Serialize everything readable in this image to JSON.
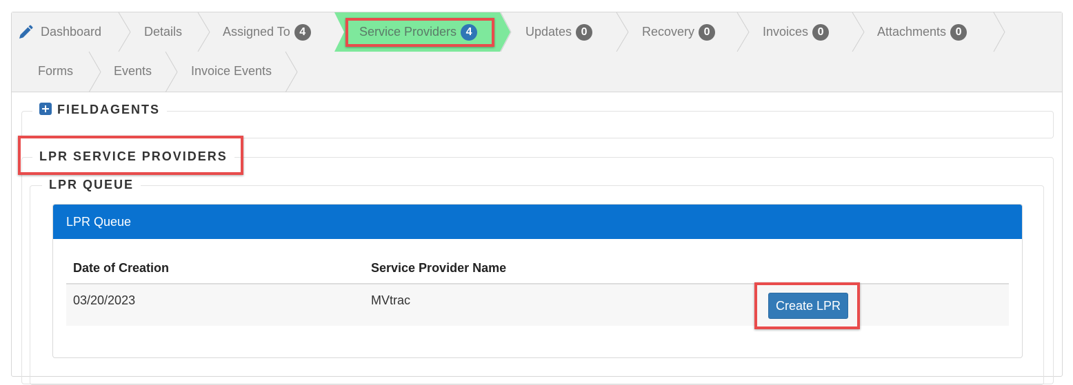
{
  "tabs": [
    {
      "label": "Dashboard",
      "icon": "pencil-icon"
    },
    {
      "label": "Details"
    },
    {
      "label": "Assigned To",
      "badge": "4"
    },
    {
      "label": "Service Providers",
      "badge": "4",
      "active": true
    },
    {
      "label": "Updates",
      "badge": "0"
    },
    {
      "label": "Recovery",
      "badge": "0"
    },
    {
      "label": "Invoices",
      "badge": "0"
    },
    {
      "label": "Attachments",
      "badge": "0"
    },
    {
      "label": "Forms"
    },
    {
      "label": "Events"
    },
    {
      "label": "Invoice Events"
    }
  ],
  "sections": {
    "fieldagents": "FIELDAGENTS",
    "lpr_service_providers": "LPR SERVICE PROVIDERS",
    "lpr_queue": "LPR QUEUE"
  },
  "queue": {
    "title": "LPR Queue",
    "columns": [
      "Date of Creation",
      "Service Provider Name"
    ],
    "rows": [
      {
        "date": "03/20/2023",
        "provider": "MVtrac",
        "action": "Create LPR"
      }
    ]
  },
  "colors": {
    "active_tab": "#7ee89c",
    "highlight": "#e84c4c",
    "queue_header": "#0a72d0",
    "button": "#337ab7"
  }
}
